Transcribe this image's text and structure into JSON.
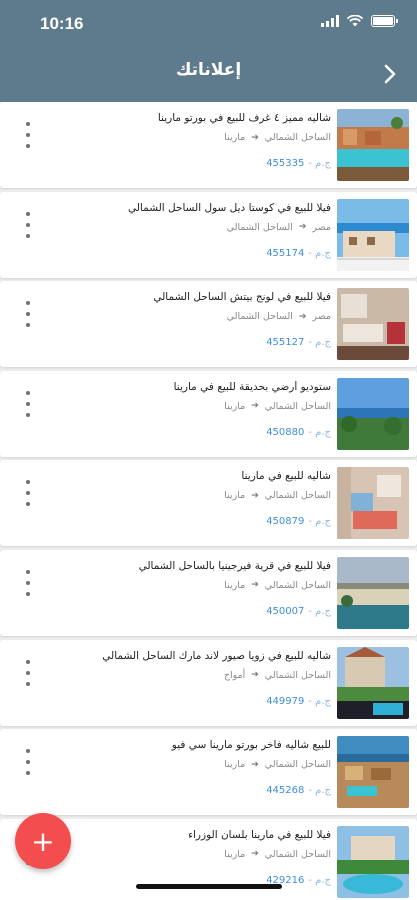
{
  "status_bar": {
    "time": "10:16",
    "wifi_icon": "wifi-icon",
    "battery_icon": "battery-icon"
  },
  "app_bar": {
    "title": "إعلاناتك",
    "back_icon": "chevron-right-icon"
  },
  "ads": [
    {
      "title": "شاليه مميز ٤ غرف للبيع في بورتو مارينا",
      "location_from": "الساحل الشمالي",
      "location_to": "مارينا",
      "currency": "ج.م -",
      "id": "455335",
      "thumb": "resort-pool"
    },
    {
      "title": "فيلا للبيع في كوستا ديل سول الساحل الشمالي",
      "location_from": "مصر",
      "location_to": "الساحل الشمالي",
      "currency": "ج.م -",
      "id": "455174",
      "thumb": "villa-sea"
    },
    {
      "title": "فيلا للبيع في لونج بيتش الساحل الشمالي",
      "location_from": "مصر",
      "location_to": "الساحل الشمالي",
      "currency": "ج.م -",
      "id": "455127",
      "thumb": "living-room"
    },
    {
      "title": "ستوديو أرضي بحديقة للبيع في مارينا",
      "location_from": "الساحل الشمالي",
      "location_to": "مارينا",
      "currency": "ج.م -",
      "id": "450880",
      "thumb": "sea-garden"
    },
    {
      "title": "شاليه للبيع في مارينا",
      "location_from": "الساحل الشمالي",
      "location_to": "مارينا",
      "currency": "ج.م -",
      "id": "450879",
      "thumb": "bedroom"
    },
    {
      "title": "فيلا للبيع في قرية فيرجينيا بالساحل الشمالي",
      "location_from": "الساحل الشمالي",
      "location_to": "مارينا",
      "currency": "ج.م -",
      "id": "450007",
      "thumb": "lagoon"
    },
    {
      "title": "شاليه للبيع في زويا صيور لاند مارك الساحل الشمالي",
      "location_from": "الساحل الشمالي",
      "location_to": "أمواج",
      "currency": "ج.م -",
      "id": "449979",
      "thumb": "villa-pool"
    },
    {
      "title": "للبيع شاليه فاخر بورتو مارينا سي فيو",
      "location_from": "الساحل الشمالي",
      "location_to": "مارينا",
      "currency": "ج.م -",
      "id": "445268",
      "thumb": "aerial-resort"
    },
    {
      "title": "فيلا للبيع في مارينا بلسان الوزراء",
      "location_from": "الساحل الشمالي",
      "location_to": "مارينا",
      "currency": "ج.م -",
      "id": "429216",
      "thumb": "garden-pool"
    }
  ],
  "fab": {
    "label": "+",
    "icon": "plus-icon"
  },
  "colors": {
    "header": "#5e7b8e",
    "price": "#3f8fd8",
    "fab": "#f44d4d"
  }
}
